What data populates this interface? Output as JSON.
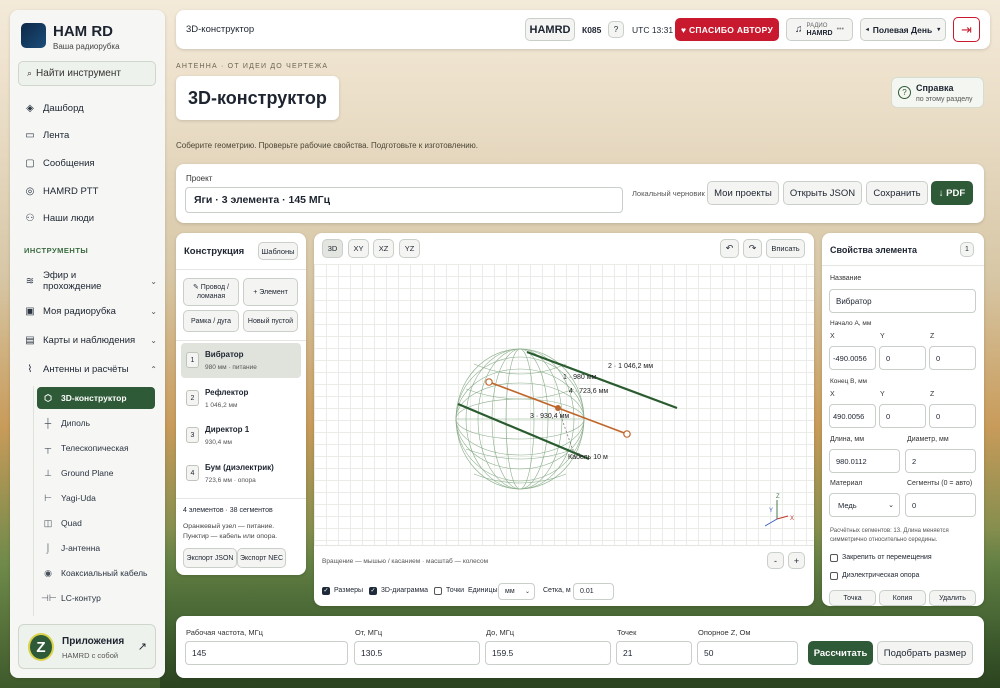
{
  "brand": {
    "name": "HAM RD",
    "subtitle": "Ваша радиорубка"
  },
  "search": {
    "placeholder": "Найти инструмент"
  },
  "nav": [
    {
      "label": "Дашборд",
      "icon": "layers-icon"
    },
    {
      "label": "Лента",
      "icon": "feed-icon"
    },
    {
      "label": "Сообщения",
      "icon": "message-icon"
    },
    {
      "label": "HAMRD PTT",
      "icon": "radio-icon"
    },
    {
      "label": "Наши люди",
      "icon": "people-icon"
    }
  ],
  "section_tools": "ИНСТРУМЕНТЫ",
  "groups": [
    {
      "label": "Эфир и прохождение",
      "icon": "wifi-icon"
    },
    {
      "label": "Моя радиорубка",
      "icon": "box-icon"
    },
    {
      "label": "Карты и наблюдения",
      "icon": "map-icon"
    },
    {
      "label": "Антенны и расчёты",
      "icon": "antenna-icon"
    }
  ],
  "subnav": [
    {
      "label": "3D-конструктор",
      "icon": "cube-icon",
      "active": true
    },
    {
      "label": "Диполь",
      "icon": "dipole-icon"
    },
    {
      "label": "Телескопическая",
      "icon": "telescope-icon"
    },
    {
      "label": "Ground Plane",
      "icon": "groundplane-icon"
    },
    {
      "label": "Yagi-Uda",
      "icon": "yagi-icon"
    },
    {
      "label": "Quad",
      "icon": "quad-icon"
    },
    {
      "label": "J-антенна",
      "icon": "j-icon"
    },
    {
      "label": "Коаксиальный кабель",
      "icon": "coax-icon"
    },
    {
      "label": "LC-контур",
      "icon": "lc-icon"
    }
  ],
  "apps_card": {
    "title": "Приложения",
    "subtitle": "HAMRD с собой"
  },
  "header": {
    "breadcrumb": "3D-конструктор",
    "hamrd": "HAMRD",
    "callsign": "К085",
    "help": "?",
    "utc": "UTC 13:31",
    "thanks": "♥ СПАСИБО АВТОРУ",
    "radio_top": "РАДИО",
    "radio_bottom": "HAMRD",
    "radio_dots": "•••",
    "mode": "Полевая День"
  },
  "hero": {
    "kicker": "АНТЕННА · ОТ ИДЕИ ДО ЧЕРТЕЖА",
    "title": "3D-конструктор",
    "lead": "Соберите геометрию. Проверьте рабочие свойства. Подготовьте к изготовлению.",
    "help_title": "Справка",
    "help_sub": "по этому разделу"
  },
  "project": {
    "label": "Проект",
    "value": "Яги · 3 элемента · 145 МГц",
    "draft": "Локальный черновик",
    "my_projects": "Мои проекты",
    "open_json": "Открыть JSON",
    "save": "Сохранить",
    "pdf": "↓ PDF"
  },
  "construct": {
    "title": "Конструкция",
    "templates": "Шаблоны",
    "add_wire": "✎ Провод / ломаная",
    "add_element": "+ Элемент",
    "frame": "Рамка / дуга",
    "new_empty": "Новый пустой",
    "elements": [
      {
        "n": "1",
        "name": "Вибратор",
        "detail": "980 мм · питание"
      },
      {
        "n": "2",
        "name": "Рефлектор",
        "detail": "1 046,2 мм"
      },
      {
        "n": "3",
        "name": "Директор 1",
        "detail": "930,4 мм"
      },
      {
        "n": "4",
        "name": "Бум (диэлектрик)",
        "detail": "723,6 мм · опора"
      }
    ],
    "summary": "4 элементов · 38 сегментов",
    "note": "Оранжевый узел — питание. Пунктир — кабель или опора.",
    "export_json": "Экспорт JSON",
    "export_nec": "Экспорт NEC"
  },
  "viewport": {
    "views": [
      "3D",
      "XY",
      "XZ",
      "YZ"
    ],
    "fit": "Вписать",
    "undo": "↶",
    "redo": "↷",
    "labels": [
      "2 · 1 046,2 мм",
      "1 · 980 мм",
      "4 · 723,6 мм",
      "3 · 930,4 мм",
      "Кабель 10 м"
    ],
    "axes": [
      "Z",
      "Y",
      "X"
    ],
    "hint": "Вращение — мышью / касанием · масштаб — колесом",
    "zoom_out": "-",
    "zoom_in": "+",
    "dims": "Размеры",
    "diagram": "3D-диаграмма",
    "points": "Точки",
    "units_label": "Единицы",
    "units": "мм",
    "grid_label": "Сетка, м",
    "grid": "0.01"
  },
  "props": {
    "title": "Свойства элемента",
    "badge": "1",
    "name_label": "Название",
    "name": "Вибратор",
    "start_label": "Начало A, мм",
    "end_label": "Конец B, мм",
    "x": "X",
    "y": "Y",
    "z": "Z",
    "ax": "-490.0056",
    "ay": "0",
    "az": "0",
    "bx": "490.0056",
    "by": "0",
    "bz": "0",
    "len_label": "Длина, мм",
    "len": "980.0112",
    "diam_label": "Диаметр, мм",
    "diam": "2",
    "mat_label": "Материал",
    "mat": "Медь",
    "seg_label": "Сегменты (0 = авто)",
    "seg": "0",
    "calc_note": "Расчётных сегментов: 13. Длина меняется симметрично относительно середины.",
    "lock": "Закрепить от перемещения",
    "dielectric": "Диэлектрическая опора",
    "point": "Точка",
    "copy": "Копия",
    "delete": "Удалить"
  },
  "calc": {
    "freq_label": "Рабочая частота, МГц",
    "freq": "145",
    "from_label": "От, МГц",
    "from": "130.5",
    "to_label": "До, МГц",
    "to": "159.5",
    "points_label": "Точек",
    "points": "21",
    "z_label": "Опорное Z, Ом",
    "z": "50",
    "calc_btn": "Рассчитать",
    "fit_btn": "Подобрать размер"
  },
  "colors": {
    "accent": "#2f5a37",
    "thanks": "#c8192e",
    "feed": "#c0652a",
    "reflector": "#2a5c30"
  }
}
